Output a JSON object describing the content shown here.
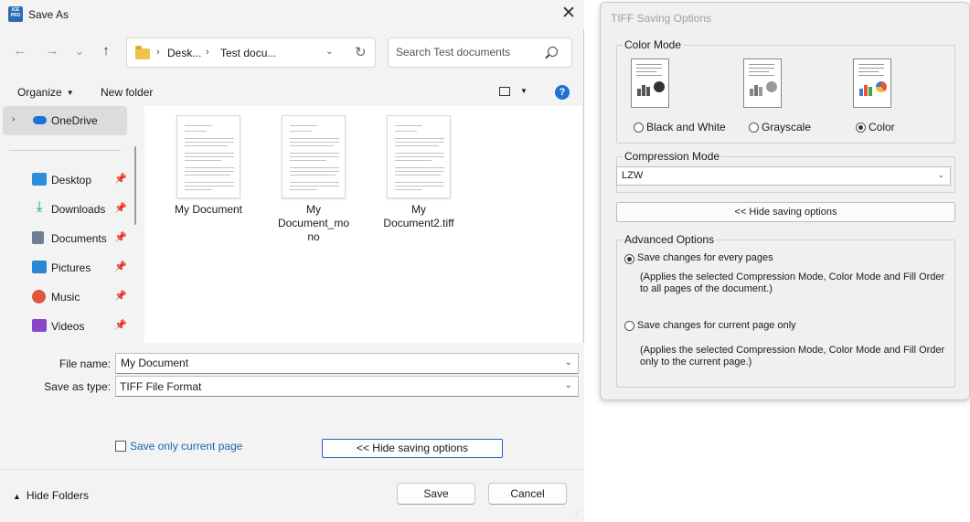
{
  "save_dialog": {
    "title": "Save As",
    "app_icon_text": "ICE PRO",
    "close_glyph": "✕",
    "nav": {
      "back": "←",
      "forward": "→",
      "recent": "⌄",
      "up": "↑"
    },
    "breadcrumb": [
      "Desk...",
      "Test docu..."
    ],
    "breadcrumb_separator": "›",
    "search_placeholder": "Search Test documents",
    "toolbar": {
      "organize": "Organize",
      "new_folder": "New folder",
      "help": "?"
    },
    "sidebar": {
      "top": "OneDrive",
      "items": [
        {
          "label": "Desktop",
          "icon": "desktop-icon",
          "color": "#2e8fd8"
        },
        {
          "label": "Downloads",
          "icon": "download-icon",
          "color": "#1b9e5a"
        },
        {
          "label": "Documents",
          "icon": "documents-icon",
          "color": "#6f7f92"
        },
        {
          "label": "Pictures",
          "icon": "pictures-icon",
          "color": "#2b86d6"
        },
        {
          "label": "Music",
          "icon": "music-icon",
          "color": "#e0573b"
        },
        {
          "label": "Videos",
          "icon": "videos-icon",
          "color": "#8a45c8"
        }
      ]
    },
    "files": [
      {
        "name": "My Document"
      },
      {
        "name": "My Document_mono"
      },
      {
        "name": "My Document2.tiff"
      }
    ],
    "file_name_label": "File name:",
    "file_name_value": "My Document",
    "save_type_label": "Save as type:",
    "save_type_value": "TIFF File Format",
    "save_current_page_label": "Save only current page",
    "hide_saving_options_label": "<< Hide saving options",
    "hide_folders_label": "Hide Folders",
    "save_button": "Save",
    "cancel_button": "Cancel"
  },
  "tiff_panel": {
    "title": "TIFF Saving Options",
    "color_mode": {
      "title": "Color Mode",
      "options": [
        {
          "label": "Black and White",
          "selected": false
        },
        {
          "label": "Grayscale",
          "selected": false
        },
        {
          "label": "Color",
          "selected": true
        }
      ]
    },
    "compression": {
      "title": "Compression Mode",
      "value": "LZW"
    },
    "hide_options_button": "<< Hide saving options",
    "advanced": {
      "title": "Advanced Options",
      "every_pages_label": "Save changes for every pages",
      "every_pages_desc": "(Applies the selected Compression Mode, Color Mode and Fill Order to all pages of the document.)",
      "current_page_label": "Save changes for current page only",
      "current_page_desc": "(Applies the selected Compression Mode, Color Mode and Fill Order only to the current page.)",
      "selected": "every_pages"
    }
  }
}
